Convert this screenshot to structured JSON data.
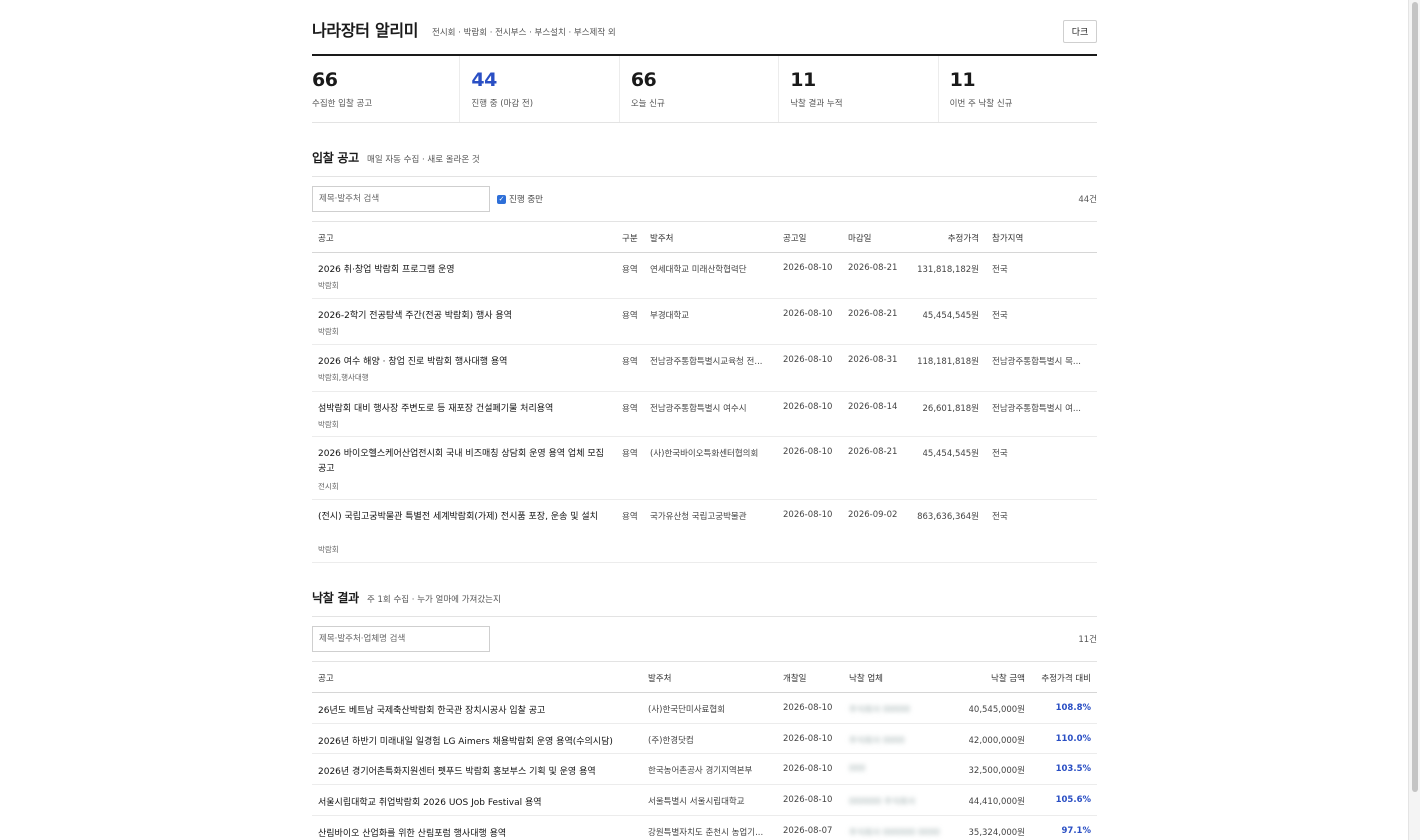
{
  "app": {
    "title": "나라장터 알리미",
    "subtitle": "전시회 · 박람회 · 전시부스 · 부스설치 · 부스제작 외",
    "dark_button": "다크"
  },
  "stats": [
    {
      "value": "66",
      "label": "수집한 입찰 공고"
    },
    {
      "value": "44",
      "label": "진행 중 (마감 전)"
    },
    {
      "value": "66",
      "label": "오늘 신규"
    },
    {
      "value": "11",
      "label": "낙찰 결과 누적"
    },
    {
      "value": "11",
      "label": "이번 주 낙찰 신규"
    }
  ],
  "bids": {
    "heading": "입찰 공고",
    "desc": "매일 자동 수집 · 새로 올라온 것",
    "search_placeholder": "제목·발주처 검색",
    "checkbox_label": "진행 중만",
    "count": "44건",
    "columns": [
      "공고",
      "구분",
      "발주처",
      "공고일",
      "마감일",
      "추정가격",
      "참가지역"
    ],
    "rows": [
      {
        "title": "2026 취·창업 박람회 프로그램 운영",
        "tag": "박람회",
        "type": "용역",
        "org": "연세대학교 미래산학협력단",
        "posted": "2026-08-10",
        "deadline": "2026-08-21",
        "price": "131,818,182원",
        "region": "전국"
      },
      {
        "title": "2026-2학기 전공탐색 주간(전공 박람회) 행사 용역",
        "tag": "박람회",
        "type": "용역",
        "org": "부경대학교",
        "posted": "2026-08-10",
        "deadline": "2026-08-21",
        "price": "45,454,545원",
        "region": "전국"
      },
      {
        "title": "2026 여수 해양 · 창업 진로 박람회 행사대행 용역",
        "tag": "박람회,행사대행",
        "type": "용역",
        "org": "전남광주통합특별시교육청 전...",
        "posted": "2026-08-10",
        "deadline": "2026-08-31",
        "price": "118,181,818원",
        "region": "전남광주통합특별시 목..."
      },
      {
        "title": "섬박람회 대비 행사장 주변도로 등 재포장 건설폐기물 처리용역",
        "tag": "박람회",
        "type": "용역",
        "org": "전남광주통합특별시 여수시",
        "posted": "2026-08-10",
        "deadline": "2026-08-14",
        "price": "26,601,818원",
        "region": "전남광주통합특별시 여..."
      },
      {
        "title": "2026 바이오헬스케어산업전시회 국내 비즈매칭 상담회 운영 용역 업체 모집 공고",
        "tag": "전시회",
        "type": "용역",
        "org": "(사)한국바이오특화센터협의회",
        "posted": "2026-08-10",
        "deadline": "2026-08-21",
        "price": "45,454,545원",
        "region": "전국"
      },
      {
        "title": "(전시) 국립고궁박물관 특별전 세계박람회(가제) 전시품 포장, 운송 및 설치",
        "tag": "박람회",
        "type": "용역",
        "org": "국가유산청 국립고궁박물관",
        "posted": "2026-08-10",
        "deadline": "2026-09-02",
        "price": "863,636,364원",
        "region": "전국"
      }
    ]
  },
  "awards": {
    "heading": "낙찰 결과",
    "desc": "주 1회 수집 · 누가 얼마에 가져갔는지",
    "search_placeholder": "제목·발주처·업체명 검색",
    "count": "11건",
    "columns": [
      "공고",
      "발주처",
      "개찰일",
      "낙찰 업체",
      "낙찰 금액",
      "추정가격 대비"
    ],
    "rows": [
      {
        "title": "26년도 베트남 국제축산박람회 한국관 장치시공사 입찰 공고",
        "org": "(사)한국단미사료협회",
        "date": "2026-08-10",
        "winner": "주식회사 00000",
        "amount": "40,545,000원",
        "ratio": "108.8%"
      },
      {
        "title": "2026년 하반기 미래내일 일경험 LG Aimers 채용박람회 운영 용역(수의시담)",
        "org": "(주)한경닷컴",
        "date": "2026-08-10",
        "winner": "주식회사 0000",
        "amount": "42,000,000원",
        "ratio": "110.0%"
      },
      {
        "title": "2026년 경기어촌특화지원센터 펫푸드 박람회 홍보부스 기획 및 운영 용역",
        "org": "한국농어촌공사 경기지역본부",
        "date": "2026-08-10",
        "winner": "000",
        "amount": "32,500,000원",
        "ratio": "103.5%"
      },
      {
        "title": "서울시립대학교 취업박람회 2026 UOS Job Festival 용역",
        "org": "서울특별시 서울시립대학교",
        "date": "2026-08-10",
        "winner": "000000 주식회사",
        "amount": "44,410,000원",
        "ratio": "105.6%"
      },
      {
        "title": "산림바이오 산업화를 위한 산림포럼 행사대행 용역",
        "org": "강원특별자치도 춘천시 농업기...",
        "date": "2026-08-07",
        "winner": "주식회사 000000 0000",
        "amount": "35,324,000원",
        "ratio": "97.1%"
      }
    ]
  }
}
